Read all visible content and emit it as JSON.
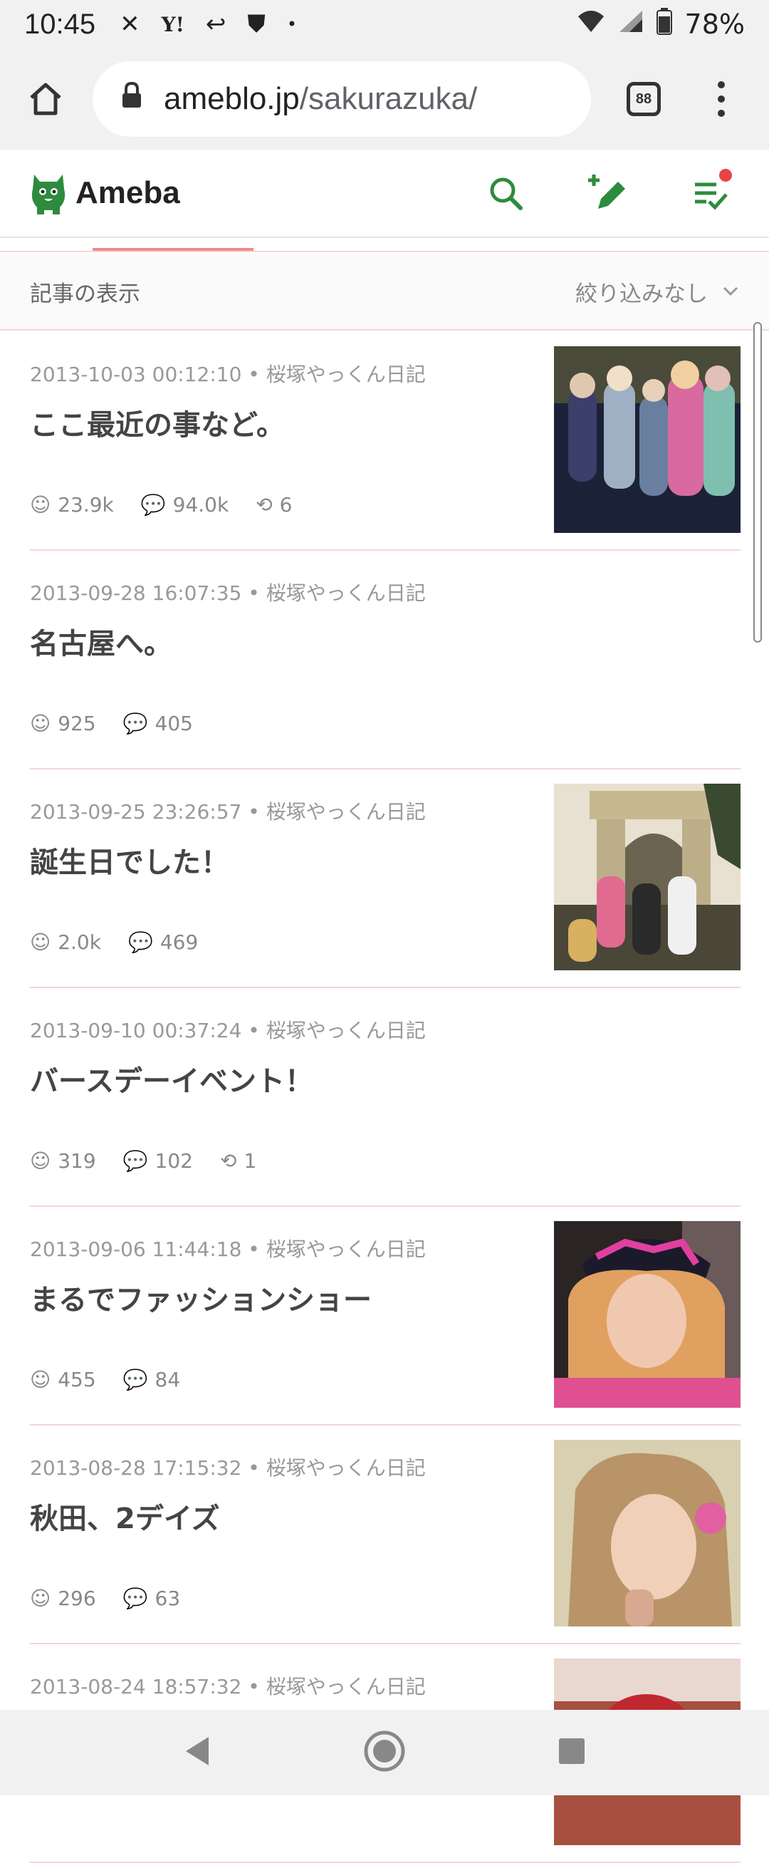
{
  "status": {
    "time": "10:45",
    "battery": "78%"
  },
  "browser": {
    "url_host": "ameblo.jp",
    "url_path": "/sakurazuka/",
    "tab_count": "88"
  },
  "header": {
    "logo_text": "Ameba"
  },
  "filter": {
    "label": "記事の表示",
    "dropdown": "絞り込みなし"
  },
  "articles": [
    {
      "meta": "2013-10-03 00:12:10 • 桜塚やっくん日記",
      "title": "ここ最近の事など。",
      "likes": "23.9k",
      "comments": "94.0k",
      "reblogs": "6"
    },
    {
      "meta": "2013-09-28 16:07:35 • 桜塚やっくん日記",
      "title": "名古屋へ。",
      "likes": "925",
      "comments": "405"
    },
    {
      "meta": "2013-09-25 23:26:57 • 桜塚やっくん日記",
      "title": "誕生日でした！",
      "likes": "2.0k",
      "comments": "469"
    },
    {
      "meta": "2013-09-10 00:37:24 • 桜塚やっくん日記",
      "title": "バースデーイベント！",
      "likes": "319",
      "comments": "102",
      "reblogs": "1"
    },
    {
      "meta": "2013-09-06 11:44:18 • 桜塚やっくん日記",
      "title": "まるでファッションショー",
      "likes": "455",
      "comments": "84"
    },
    {
      "meta": "2013-08-28 17:15:32 • 桜塚やっくん日記",
      "title": "秋田、2デイズ",
      "likes": "296",
      "comments": "63"
    },
    {
      "meta": "2013-08-24 18:57:32 • 桜塚やっくん日記"
    }
  ],
  "colors": {
    "accent_green": "#2e8b3d",
    "accent_pink": "#f08a8a"
  }
}
